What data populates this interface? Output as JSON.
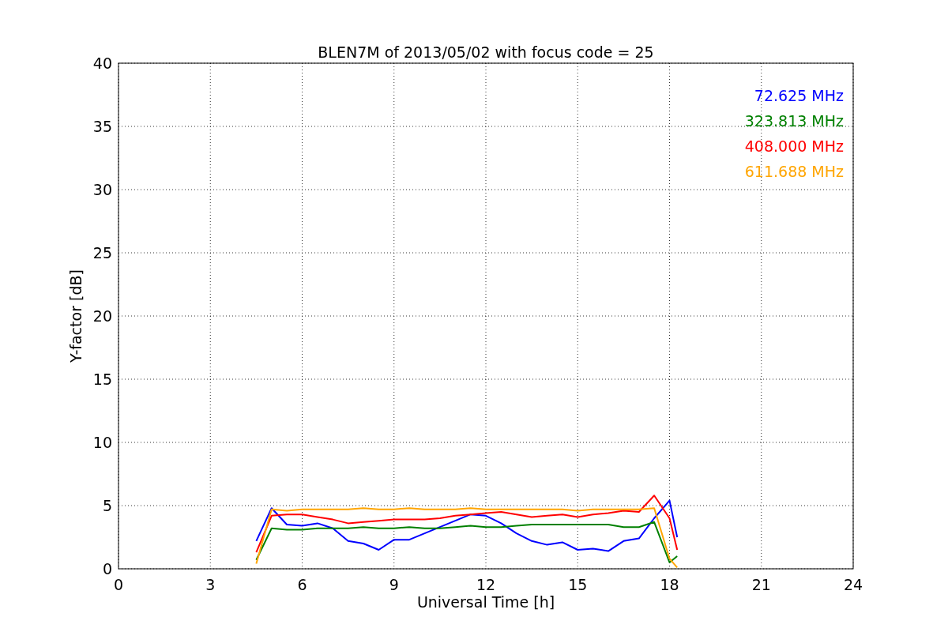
{
  "chart_data": {
    "type": "line",
    "title": "BLEN7M of 2013/05/02 with focus code = 25",
    "xlabel": "Universal Time [h]",
    "ylabel": "Y-factor [dB]",
    "x": [
      4.5,
      5,
      5.5,
      6,
      6.5,
      7,
      7.5,
      8,
      8.5,
      9,
      9.5,
      10,
      10.5,
      11,
      11.5,
      12,
      12.5,
      13,
      13.5,
      14,
      14.5,
      15,
      15.5,
      16,
      16.5,
      17,
      17.5,
      18,
      18.25
    ],
    "series": [
      {
        "name": "72.625 MHz",
        "color": "#0000ff",
        "values": [
          2.2,
          4.8,
          3.5,
          3.4,
          3.6,
          3.2,
          2.2,
          2.0,
          1.5,
          2.3,
          2.3,
          2.8,
          3.3,
          3.8,
          4.3,
          4.2,
          3.6,
          2.8,
          2.2,
          1.9,
          2.1,
          1.5,
          1.6,
          1.4,
          2.2,
          2.4,
          4.0,
          5.4,
          2.5
        ]
      },
      {
        "name": "323.813 MHz",
        "color": "#008000",
        "values": [
          0.7,
          3.2,
          3.1,
          3.1,
          3.2,
          3.2,
          3.2,
          3.3,
          3.2,
          3.2,
          3.3,
          3.2,
          3.2,
          3.3,
          3.4,
          3.3,
          3.3,
          3.4,
          3.5,
          3.5,
          3.5,
          3.5,
          3.5,
          3.5,
          3.3,
          3.3,
          3.7,
          0.5,
          1.0
        ]
      },
      {
        "name": "408.000 MHz",
        "color": "#ff0000",
        "values": [
          1.3,
          4.2,
          4.3,
          4.3,
          4.1,
          3.9,
          3.6,
          3.7,
          3.8,
          3.9,
          3.9,
          3.9,
          4.0,
          4.2,
          4.3,
          4.4,
          4.5,
          4.3,
          4.1,
          4.2,
          4.3,
          4.1,
          4.3,
          4.4,
          4.6,
          4.5,
          5.8,
          4.0,
          1.5
        ]
      },
      {
        "name": "611.688 MHz",
        "color": "#ffa500",
        "values": [
          0.4,
          4.7,
          4.6,
          4.7,
          4.7,
          4.7,
          4.7,
          4.8,
          4.7,
          4.7,
          4.8,
          4.7,
          4.7,
          4.7,
          4.8,
          4.7,
          4.7,
          4.7,
          4.7,
          4.7,
          4.7,
          4.6,
          4.7,
          4.7,
          4.7,
          4.7,
          4.8,
          0.8,
          0.1
        ]
      }
    ],
    "xlim": [
      0,
      24
    ],
    "ylim": [
      0,
      40
    ],
    "xticks": [
      0,
      3,
      6,
      9,
      12,
      15,
      18,
      21,
      24
    ],
    "yticks": [
      0,
      5,
      10,
      15,
      20,
      25,
      30,
      35,
      40
    ],
    "grid": true
  }
}
